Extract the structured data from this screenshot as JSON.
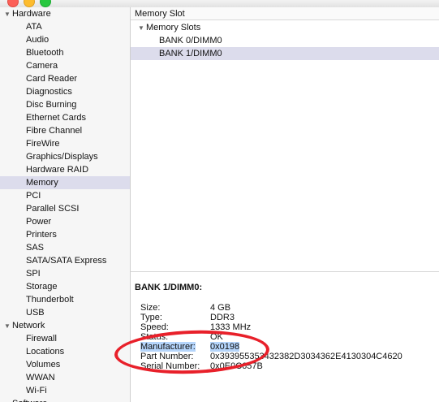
{
  "sidebar": {
    "sections": [
      {
        "label": "Hardware",
        "items": [
          "ATA",
          "Audio",
          "Bluetooth",
          "Camera",
          "Card Reader",
          "Diagnostics",
          "Disc Burning",
          "Ethernet Cards",
          "Fibre Channel",
          "FireWire",
          "Graphics/Displays",
          "Hardware RAID",
          "Memory",
          "PCI",
          "Parallel SCSI",
          "Power",
          "Printers",
          "SAS",
          "SATA/SATA Express",
          "SPI",
          "Storage",
          "Thunderbolt",
          "USB"
        ]
      },
      {
        "label": "Network",
        "items": [
          "Firewall",
          "Locations",
          "Volumes",
          "WWAN",
          "Wi-Fi"
        ]
      },
      {
        "label": "Software",
        "items": []
      }
    ],
    "selected": "Memory"
  },
  "main": {
    "column_header": "Memory Slot",
    "tree": {
      "group_label": "Memory Slots",
      "rows": [
        "BANK 0/DIMM0",
        "BANK 1/DIMM0"
      ],
      "selected": "BANK 1/DIMM0"
    },
    "detail": {
      "title": "BANK 1/DIMM0:",
      "fields": [
        {
          "key": "Size:",
          "value": "4 GB"
        },
        {
          "key": "Type:",
          "value": "DDR3"
        },
        {
          "key": "Speed:",
          "value": "1333 MHz"
        },
        {
          "key": "Status:",
          "value": "OK"
        },
        {
          "key": "Manufacturer:",
          "value": "0x0198"
        },
        {
          "key": "Part Number:",
          "value": "0x393955353432382D3034362E4130304C4620"
        },
        {
          "key": "Serial Number:",
          "value": "0x0E0C657B"
        }
      ],
      "highlighted": "Manufacturer:"
    }
  },
  "annotation_color": "#e8202a",
  "selection_color": "#dcdcec"
}
